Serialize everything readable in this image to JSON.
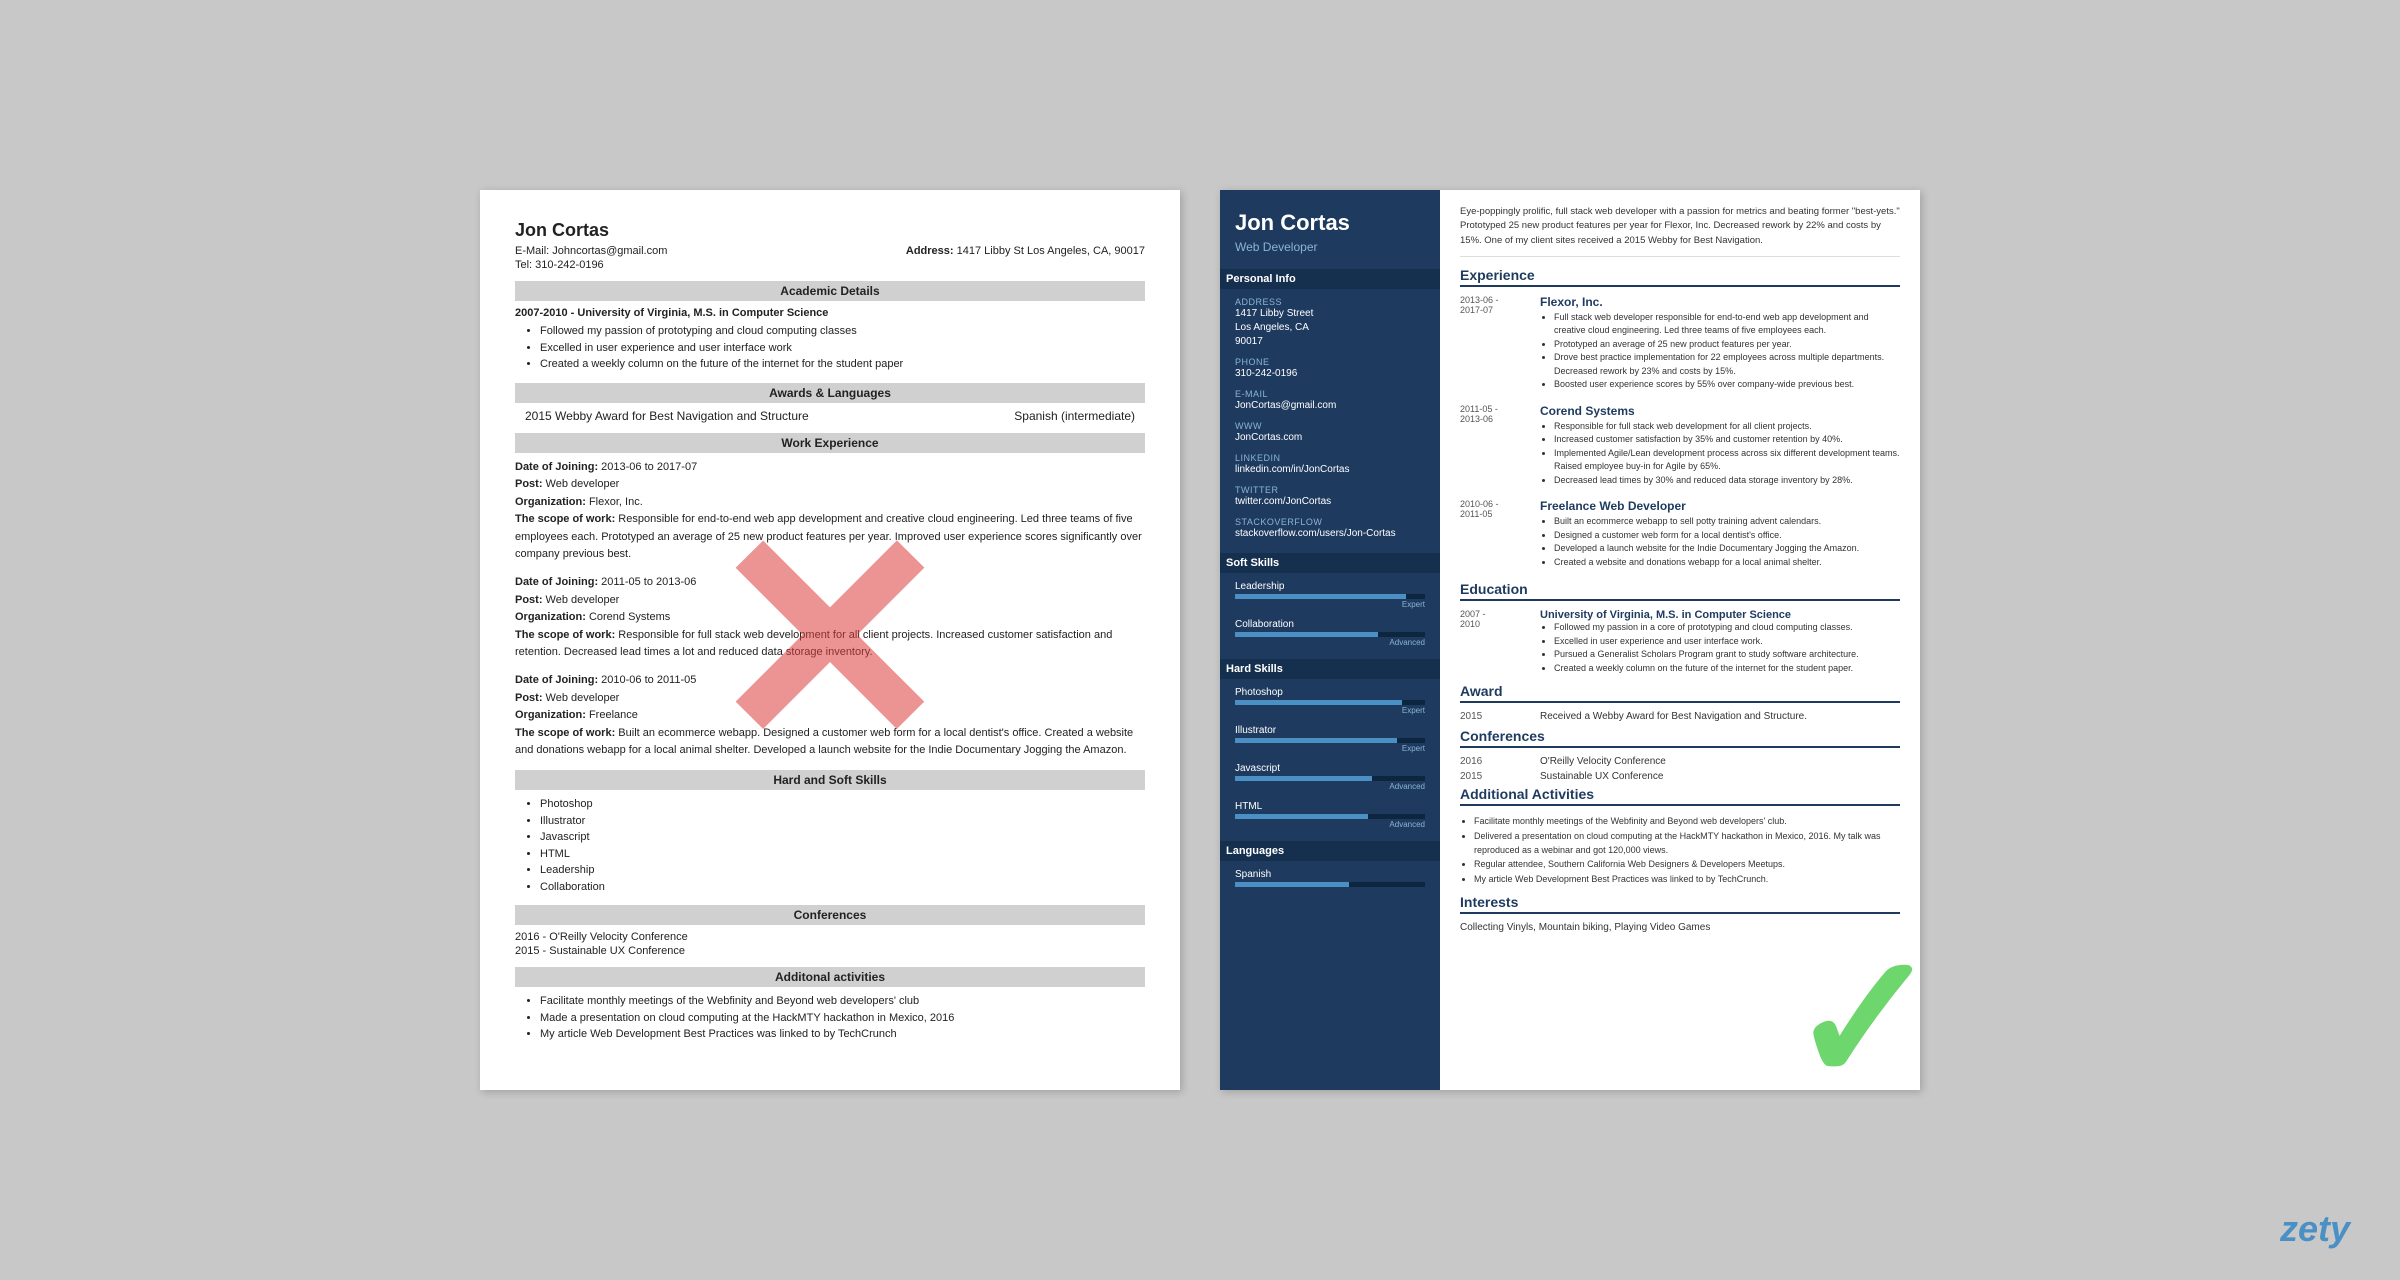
{
  "left_resume": {
    "name": "Jon Cortas",
    "email": "E-Mail: Johncortas@gmail.com",
    "tel": "Tel: 310-242-0196",
    "address_label": "Address:",
    "address": "1417 Libby St Los Angeles, CA, 90017",
    "sections": {
      "academic": {
        "title": "Academic Details",
        "entry": "2007-2010 - University of Virginia, M.S. in Computer Science",
        "bullets": [
          "Followed my passion of prototyping and cloud computing classes",
          "Excelled in user experience and user interface work",
          "Created a weekly column on the future of the internet for the student paper"
        ]
      },
      "awards": {
        "title": "Awards & Languages",
        "award": "2015 Webby Award for Best Navigation and Structure",
        "language": "Spanish (intermediate)"
      },
      "work": {
        "title": "Work Experience",
        "jobs": [
          {
            "date": "Date of Joining: 2013-06 to 2017-07",
            "post": "Post: Web developer",
            "org": "Organization: Flexor, Inc.",
            "scope_label": "The scope of work:",
            "scope": "Responsible for end-to-end web app development and creative cloud engineering. Led three teams of five employees each. Prototyped an average of 25 new product features per year. Improved user experience scores significantly over company previous best."
          },
          {
            "date": "Date of Joining: 2011-05 to 2013-06",
            "post": "Post: Web developer",
            "org": "Organization: Corend Systems",
            "scope_label": "The scope of work:",
            "scope": "Responsible for full stack web development for all client projects. Increased customer satisfaction and retention. Decreased lead times a lot and reduced data storage inventory."
          },
          {
            "date": "Date of Joining: 2010-06 to 2011-05",
            "post": "Post: Web developer",
            "org": "Organization: Freelance",
            "scope_label": "The scope of work:",
            "scope": "Built an ecommerce webapp. Designed a customer web form for a local dentist's office. Created a website and donations webapp for a local animal shelter. Developed a launch website for the Indie Documentary Jogging the Amazon."
          }
        ]
      },
      "skills": {
        "title": "Hard and Soft Skills",
        "items": [
          "Photoshop",
          "Illustrator",
          "Javascript",
          "HTML",
          "Leadership",
          "Collaboration"
        ]
      },
      "conferences": {
        "title": "Conferences",
        "items": [
          "2016 - O'Reilly Velocity Conference",
          "2015 - Sustainable UX Conference"
        ]
      },
      "activities": {
        "title": "Additonal activities",
        "bullets": [
          "Facilitate monthly meetings of the Webfinity and Beyond web developers' club",
          "Made a presentation on cloud computing at the HackMTY hackathon in Mexico, 2016",
          "My article Web Development Best Practices was linked to by TechCrunch"
        ]
      }
    }
  },
  "right_resume": {
    "name": "Jon Cortas",
    "title": "Web Developer",
    "summary": "Eye-poppingly prolific, full stack web developer with a passion for metrics and beating former \"best-yets.\" Prototyped 25 new product features per year for Flexor, Inc. Decreased rework by 22% and costs by 15%. One of my client sites received a 2015 Webby for Best Navigation.",
    "sidebar": {
      "personal_info_title": "Personal Info",
      "address_label": "Address",
      "address": "1417 Libby Street\nLos Angeles, CA\n90017",
      "phone_label": "Phone",
      "phone": "310-242-0196",
      "email_label": "E-mail",
      "email": "JonCortas@gmail.com",
      "www_label": "WWW",
      "www": "JonCortas.com",
      "linkedin_label": "LinkedIn",
      "linkedin": "linkedin.com/in/JonCortas",
      "twitter_label": "Twitter",
      "twitter": "twitter.com/JonCortas",
      "stackoverflow_label": "StackOverflow",
      "stackoverflow": "stackoverflow.com/users/Jon-Cortas",
      "soft_skills_title": "Soft Skills",
      "soft_skills": [
        {
          "name": "Leadership",
          "pct": 90,
          "level": "Expert"
        },
        {
          "name": "Collaboration",
          "pct": 75,
          "level": "Advanced"
        }
      ],
      "hard_skills_title": "Hard Skills",
      "hard_skills": [
        {
          "name": "Photoshop",
          "pct": 88,
          "level": "Expert"
        },
        {
          "name": "Illustrator",
          "pct": 85,
          "level": "Expert"
        },
        {
          "name": "Javascript",
          "pct": 72,
          "level": "Advanced"
        },
        {
          "name": "HTML",
          "pct": 70,
          "level": "Advanced"
        }
      ],
      "languages_title": "Languages",
      "languages": [
        {
          "name": "Spanish",
          "pct": 60,
          "level": ""
        }
      ]
    },
    "experience_title": "Experience",
    "experience": [
      {
        "date": "2013-06 -\n2017-07",
        "company": "Flexor, Inc.",
        "bullets": [
          "Full stack web developer responsible for end-to-end web app development and creative cloud engineering. Led three teams of five employees each.",
          "Prototyped an average of 25 new product features per year.",
          "Drove best practice implementation for 22 employees across multiple departments. Decreased rework by 23% and costs by 15%.",
          "Boosted user experience scores by 55% over company-wide previous best."
        ]
      },
      {
        "date": "2011-05 -\n2013-06",
        "company": "Corend Systems",
        "bullets": [
          "Responsible for full stack web development for all client projects.",
          "Increased customer satisfaction by 35% and customer retention by 40%.",
          "Implemented Agile/Lean development process across six different development teams. Raised employee buy-in for Agile by 65%.",
          "Decreased lead times by 30% and reduced data storage inventory by 28%."
        ]
      },
      {
        "date": "2010-06 -\n2011-05",
        "company": "Freelance Web Developer",
        "bullets": [
          "Built an ecommerce webapp to sell potty training advent calendars.",
          "Designed a customer web form for a local dentist's office.",
          "Developed a launch website for the Indie Documentary Jogging the Amazon.",
          "Created a website and donations webapp for a local animal shelter."
        ]
      }
    ],
    "education_title": "Education",
    "education": [
      {
        "date": "2007 -\n2010",
        "school": "University of Virginia, M.S. in Computer Science",
        "bullets": [
          "Followed my passion in a core of prototyping and cloud computing classes.",
          "Excelled in user experience and user interface work.",
          "Pursued a Generalist Scholars Program grant to study software architecture.",
          "Created a weekly column on the future of the internet for the student paper."
        ]
      }
    ],
    "award_title": "Award",
    "award": {
      "year": "2015",
      "desc": "Received a Webby Award for Best Navigation and Structure."
    },
    "conferences_title": "Conferences",
    "conferences": [
      {
        "year": "2016",
        "name": "O'Reilly Velocity Conference"
      },
      {
        "year": "2015",
        "name": "Sustainable UX Conference"
      }
    ],
    "activities_title": "Additional Activities",
    "activities": [
      "Facilitate monthly meetings of the Webfinity and Beyond web developers' club.",
      "Delivered a presentation on cloud computing at the HackMTY hackathon in Mexico, 2016. My talk was reproduced as a webinar and got 120,000 views.",
      "Regular attendee, Southern California Web Designers & Developers Meetups.",
      "My article Web Development Best Practices was linked to by TechCrunch."
    ],
    "interests_title": "Interests",
    "interests": "Collecting Vinyls, Mountain biking, Playing Video Games"
  },
  "watermark": "zety"
}
